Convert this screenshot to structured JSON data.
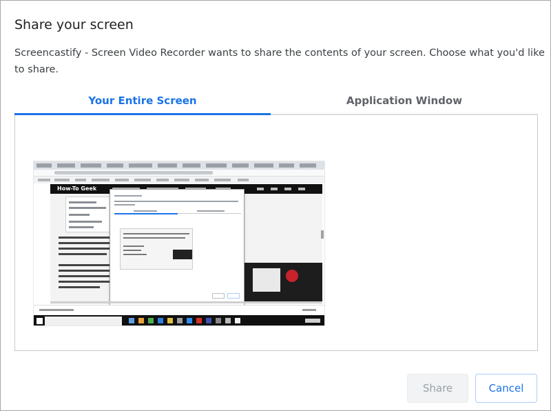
{
  "dialog": {
    "title": "Share your screen",
    "description": "Screencastify - Screen Video Recorder wants to share the contents of your screen. Choose what you'd like to share."
  },
  "tabs": [
    {
      "label": "Your Entire Screen",
      "active": true
    },
    {
      "label": "Application Window",
      "active": false
    }
  ],
  "thumbnail": {
    "site_logo_text": "How-To Geek"
  },
  "buttons": {
    "share_label": "Share",
    "cancel_label": "Cancel"
  },
  "colors": {
    "accent": "#1a73e8",
    "disabled_text": "#9aa0a6",
    "disabled_bg": "#f1f3f4"
  }
}
